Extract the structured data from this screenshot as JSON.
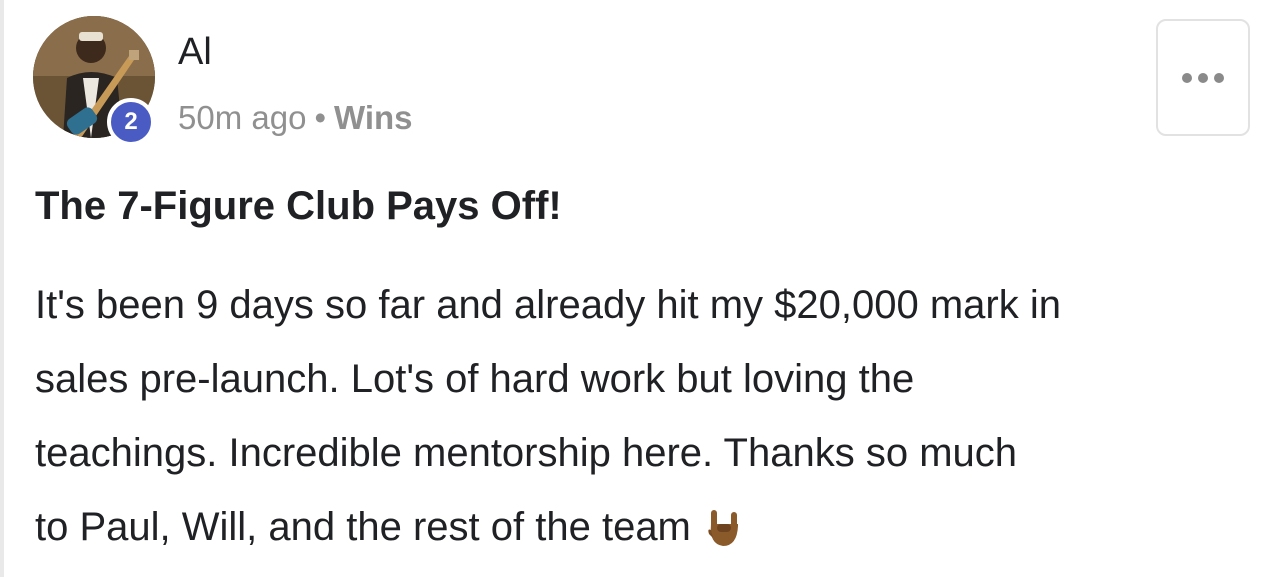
{
  "post": {
    "author": "Al",
    "level": "2",
    "time": "50m ago",
    "separator": "•",
    "category": "Wins",
    "title": "The 7-Figure Club Pays Off!",
    "body_lines": [
      "It's been 9 days so far and already hit my $20,000 mark in",
      "sales pre-launch. Lot's of hard work but loving the",
      "teachings. Incredible mentorship here. Thanks so much",
      "to Paul, Will, and the rest of the team"
    ],
    "emoji": "rock-on-hand-icon"
  },
  "colors": {
    "badge": "#4a5cc4",
    "meta_text": "#909090",
    "text": "#202124"
  },
  "icons": {
    "more": "more-options-icon"
  }
}
